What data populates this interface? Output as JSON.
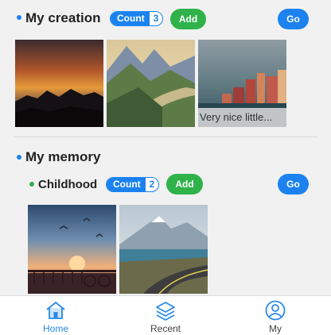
{
  "colors": {
    "accent_blue": "#1b82ef",
    "accent_green": "#2fb24a",
    "background": "#f1f1f1"
  },
  "creation": {
    "title": "My creation",
    "count_label": "Count",
    "count_value": "3",
    "add_label": "Add",
    "go_label": "Go",
    "images": [
      {
        "name": "sunset-silhouette-image",
        "caption": ""
      },
      {
        "name": "mountain-valley-image",
        "caption": ""
      },
      {
        "name": "seaside-town-image",
        "caption": "Very nice little..."
      }
    ]
  },
  "memory": {
    "title": "My memory",
    "album": {
      "title": "Childhood",
      "count_label": "Count",
      "count_value": "2",
      "add_label": "Add",
      "go_label": "Go",
      "images": [
        {
          "name": "sunset-balcony-image"
        },
        {
          "name": "mountain-road-image"
        }
      ]
    }
  },
  "tabbar": {
    "tabs": [
      {
        "label": "Home",
        "icon": "home-icon",
        "active": true
      },
      {
        "label": "Recent",
        "icon": "layers-icon",
        "active": false
      },
      {
        "label": "My",
        "icon": "user-icon",
        "active": false
      }
    ]
  }
}
